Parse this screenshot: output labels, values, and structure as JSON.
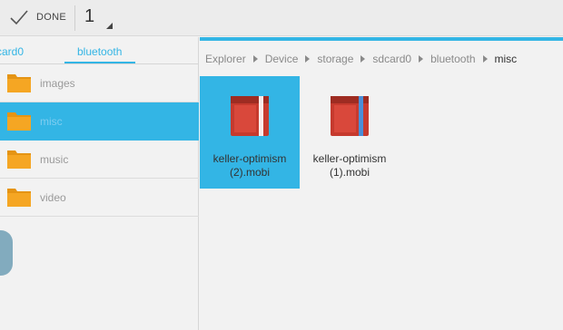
{
  "actionbar": {
    "done_label": "DONE",
    "selected_count": "1"
  },
  "left_pane": {
    "tabs": [
      {
        "label": "card0",
        "active": false
      },
      {
        "label": "bluetooth",
        "active": true
      }
    ],
    "folders": [
      {
        "name": "images",
        "selected": false
      },
      {
        "name": "misc",
        "selected": true
      },
      {
        "name": "music",
        "selected": false
      },
      {
        "name": "video",
        "selected": false
      }
    ]
  },
  "right_pane": {
    "breadcrumb": [
      "Explorer",
      "Device",
      "storage",
      "sdcard0",
      "bluetooth",
      "misc"
    ],
    "files": [
      {
        "line1": "keller-optimism",
        "line2": "(2).mobi",
        "selected": true
      },
      {
        "line1": "keller-optimism",
        "line2": "(1).mobi",
        "selected": false
      }
    ]
  },
  "colors": {
    "accent": "#33b5e5",
    "folder": "#f5a623",
    "book": "#c63a2e"
  },
  "icons": {
    "done": "check-icon",
    "folder": "folder-icon",
    "file": "book-icon",
    "breadcrumb_separator": "triangle-right-icon"
  }
}
